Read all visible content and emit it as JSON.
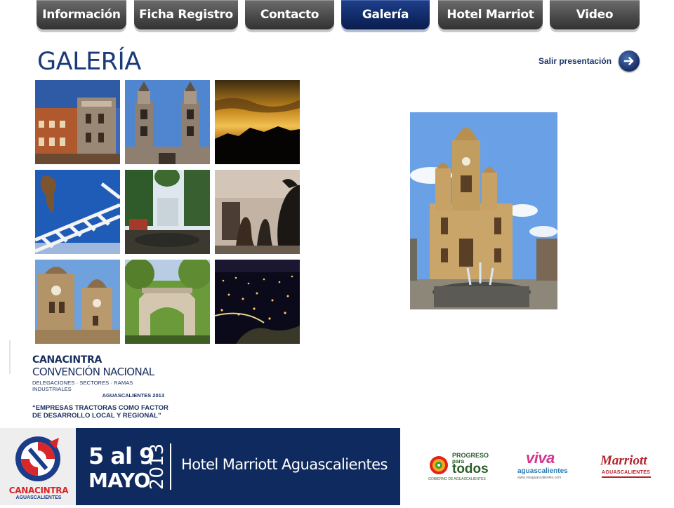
{
  "nav": {
    "tabs": [
      {
        "label": "Información",
        "active": false
      },
      {
        "label": "Ficha Registro",
        "active": false
      },
      {
        "label": "Contacto",
        "active": false
      },
      {
        "label": "Galería",
        "active": true
      },
      {
        "label": "Hotel Marriot",
        "active": false
      },
      {
        "label": "Video",
        "active": false
      }
    ]
  },
  "page": {
    "title": "GALERÍA",
    "exit_label": "Salir presentación",
    "exit_icon": "arrow-right-circle-icon"
  },
  "gallery": {
    "thumbnails": [
      "building-tower",
      "cathedral-towers",
      "sunset-mountains",
      "sculpture-sky",
      "plaza-garden",
      "bronze-sculptures",
      "cathedral-closeup",
      "stone-arch-park",
      "city-night"
    ],
    "selected": "cathedral-fountain"
  },
  "event_logo": {
    "org": "CANACINTRA",
    "name": "CONVENCIÓN NACIONAL",
    "sectors": "DELEGACIONES · SECTORES · RAMAS INDUSTRIALES",
    "place_year": "AGUASCALIENTES 2013",
    "slogan_line1": "“EMPRESAS TRACTORAS COMO FACTOR",
    "slogan_line2": "DE DESARROLLO LOCAL Y REGIONAL”"
  },
  "footer": {
    "org_name": "CANACINTRA",
    "org_city": "AGUASCALIENTES",
    "date_text": "5 al 9",
    "month": "MAYO",
    "year": "2013",
    "venue": "Hotel Marriott Aguascalientes",
    "band_color": "#0e2a5e",
    "sponsors": {
      "gov_line1": "PROGRESO",
      "gov_line2": "para",
      "gov_line3": "todos",
      "gov_caption": "GOBIERNO DE AGUASCALIENTES",
      "viva": "viva",
      "viva_sub": "aguascalientes",
      "viva_url": "www.vivaguascalientes.com",
      "marriott": "Marriott",
      "marriott_sub": "AGUASCALIENTES"
    }
  }
}
